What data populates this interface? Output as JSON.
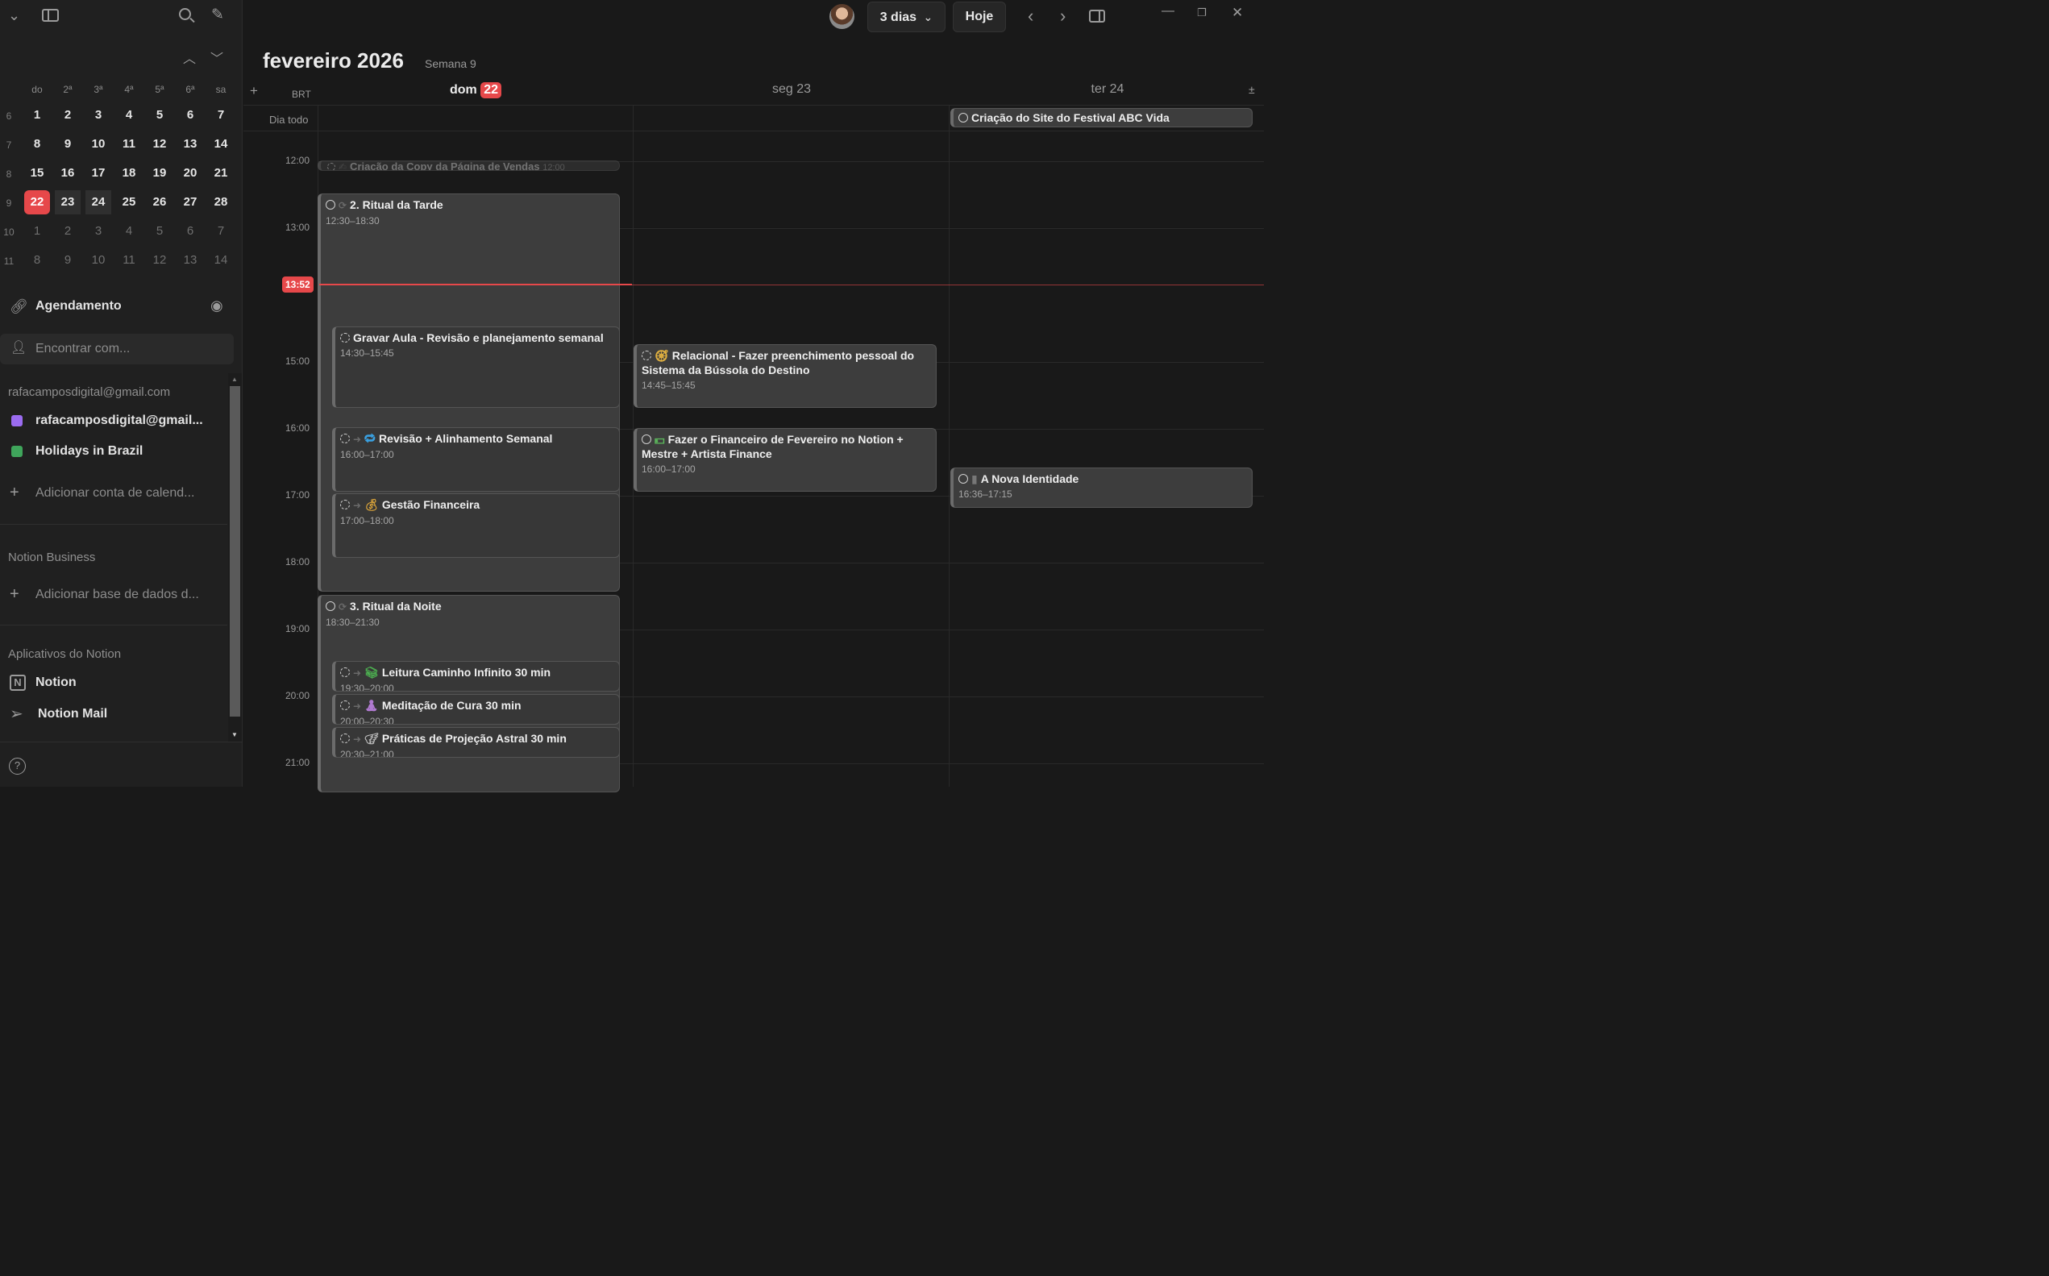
{
  "sidebar": {
    "mini_calendar": {
      "weekdays": [
        "do",
        "2ª",
        "3ª",
        "4ª",
        "5ª",
        "6ª",
        "sa"
      ],
      "weeks": [
        {
          "wk": "6",
          "days": [
            "1",
            "2",
            "3",
            "4",
            "5",
            "6",
            "7"
          ]
        },
        {
          "wk": "7",
          "days": [
            "8",
            "9",
            "10",
            "11",
            "12",
            "13",
            "14"
          ]
        },
        {
          "wk": "8",
          "days": [
            "15",
            "16",
            "17",
            "18",
            "19",
            "20",
            "21"
          ]
        },
        {
          "wk": "9",
          "days": [
            "22",
            "23",
            "24",
            "25",
            "26",
            "27",
            "28"
          ]
        },
        {
          "wk": "10",
          "days": [
            "1",
            "2",
            "3",
            "4",
            "5",
            "6",
            "7"
          ]
        },
        {
          "wk": "11",
          "days": [
            "8",
            "9",
            "10",
            "11",
            "12",
            "13",
            "14"
          ]
        }
      ]
    },
    "scheduling_label": "Agendamento",
    "search_placeholder": "Encontrar com...",
    "account_email": "rafacamposdigital@gmail.com",
    "calendars": [
      {
        "label": "rafacamposdigital@gmail...",
        "color": "#9b6cf0"
      },
      {
        "label": "Holidays in Brazil",
        "color": "#3fa55b"
      }
    ],
    "add_calendar_account": "Adicionar conta de calend...",
    "business_section": "Notion Business",
    "add_database": "Adicionar base de dados d...",
    "apps_section": "Aplicativos do Notion",
    "apps": [
      "Notion",
      "Notion Mail"
    ]
  },
  "toolbar": {
    "view_label": "3 dias",
    "today_label": "Hoje"
  },
  "header": {
    "month_title": "fevereiro 2026",
    "week_label": "Semana 9",
    "timezone": "BRT",
    "all_day_label": "Dia todo",
    "days": [
      {
        "name": "dom",
        "num": "22"
      },
      {
        "name": "seg 23"
      },
      {
        "name": "ter 24"
      }
    ]
  },
  "hours": [
    "12:00",
    "13:00",
    "15:00",
    "16:00",
    "17:00",
    "18:00",
    "19:00",
    "20:00",
    "21:00"
  ],
  "now_label": "13:52",
  "all_day_event": "Criação do Site do Festival ABC Vida",
  "events": {
    "copy": {
      "title": "Criação da Copy da Página de Vendas",
      "time": "12:00"
    },
    "tarde": {
      "title": "2. Ritual da Tarde",
      "time": "12:30–18:30"
    },
    "aula": {
      "title": "Gravar Aula - Revisão e planejamento semanal",
      "time": "14:30–15:45"
    },
    "revisao": {
      "title": "Revisão + Alinhamento Semanal",
      "time": "16:00–17:00"
    },
    "gestao": {
      "title": "Gestão Financeira",
      "time": "17:00–18:00"
    },
    "noite": {
      "title": "3. Ritual da Noite",
      "time": "18:30–21:30"
    },
    "leitura": {
      "title": "Leitura Caminho Infinito 30 min",
      "time": "19:30–20:00"
    },
    "meditacao": {
      "title": "Meditação de Cura 30 min",
      "time": "20:00–20:30"
    },
    "praticas": {
      "title": "Práticas de Projeção Astral 30 min",
      "time": "20:30–21:00"
    },
    "relacional": {
      "title": "Relacional - Fazer preenchimento pessoal do Sistema da Bússola do Destino",
      "time": "14:45–15:45"
    },
    "financeiro": {
      "title": "Fazer o Financeiro de Fevereiro no Notion + Mestre + Artista Finance",
      "time": "16:00–17:00"
    },
    "identidade": {
      "title": "A Nova Identidade",
      "time": "16:36–17:15"
    }
  }
}
